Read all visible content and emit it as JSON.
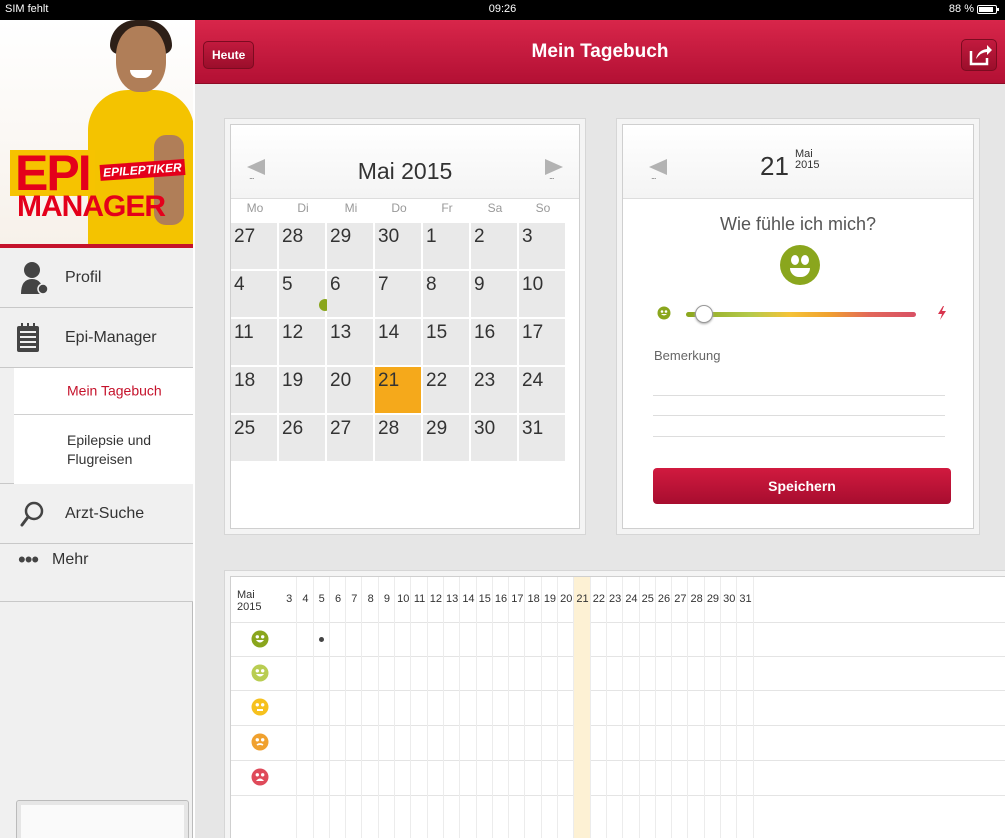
{
  "status_bar": {
    "carrier": "SIM fehlt",
    "time": "09:26",
    "battery": "88 %"
  },
  "sidebar": {
    "logo_line1": "EPI",
    "logo_line2": "MANAGER",
    "logo_tag": "EPILEPTIKER",
    "items": [
      {
        "label": "Profil",
        "icon": "person-icon"
      },
      {
        "label": "Epi-Manager",
        "icon": "notepad-icon"
      },
      {
        "label": "Arzt-Suche",
        "icon": "magnifier-icon"
      },
      {
        "label": "Mehr",
        "icon": "more-dots-icon"
      }
    ],
    "subitems": [
      {
        "label": "Mein Tagebuch",
        "selected": true
      },
      {
        "label": "Epilepsie und Flugreisen",
        "line1": "Epilepsie und",
        "line2": "Flugreisen",
        "selected": false
      }
    ]
  },
  "navbar": {
    "title": "Mein Tagebuch",
    "today_button": "Heute",
    "share_icon": "share-icon"
  },
  "calendar": {
    "title": "Mai 2015",
    "weekdays": [
      "Mo",
      "Di",
      "Mi",
      "Do",
      "Fr",
      "Sa",
      "So"
    ],
    "weeks": [
      [
        "27",
        "28",
        "29",
        "30",
        "1",
        "2",
        "3"
      ],
      [
        "4",
        "5",
        "6",
        "7",
        "8",
        "9",
        "10"
      ],
      [
        "11",
        "12",
        "13",
        "14",
        "15",
        "16",
        "17"
      ],
      [
        "18",
        "19",
        "20",
        "21",
        "22",
        "23",
        "24"
      ],
      [
        "25",
        "26",
        "27",
        "28",
        "29",
        "30",
        "31"
      ]
    ],
    "selected_day": "21",
    "marked_day": "5",
    "selected_color": "#f5a91b"
  },
  "mood": {
    "day": "21",
    "month": "Mai",
    "year": "2015",
    "question": "Wie fühle ich mich?",
    "remark_label": "Bemerkung",
    "save_button": "Speichern",
    "slider_value": 0.08
  },
  "grid": {
    "month": "Mai",
    "year": "2015",
    "days": [
      "3",
      "4",
      "5",
      "6",
      "7",
      "8",
      "9",
      "10",
      "11",
      "12",
      "13",
      "14",
      "15",
      "16",
      "17",
      "18",
      "19",
      "20",
      "21",
      "22",
      "23",
      "24",
      "25",
      "26",
      "27",
      "28",
      "29",
      "30",
      "31"
    ],
    "highlight_day": "21",
    "mood_rows": [
      "very-good",
      "good",
      "neutral",
      "bad",
      "very-bad"
    ],
    "entries": [
      {
        "day": "5",
        "mood": "very-good"
      }
    ]
  },
  "colors": {
    "brand_red": "#c5122b",
    "accent_orange": "#f5a91b",
    "mood_green": "#8aa61d"
  }
}
